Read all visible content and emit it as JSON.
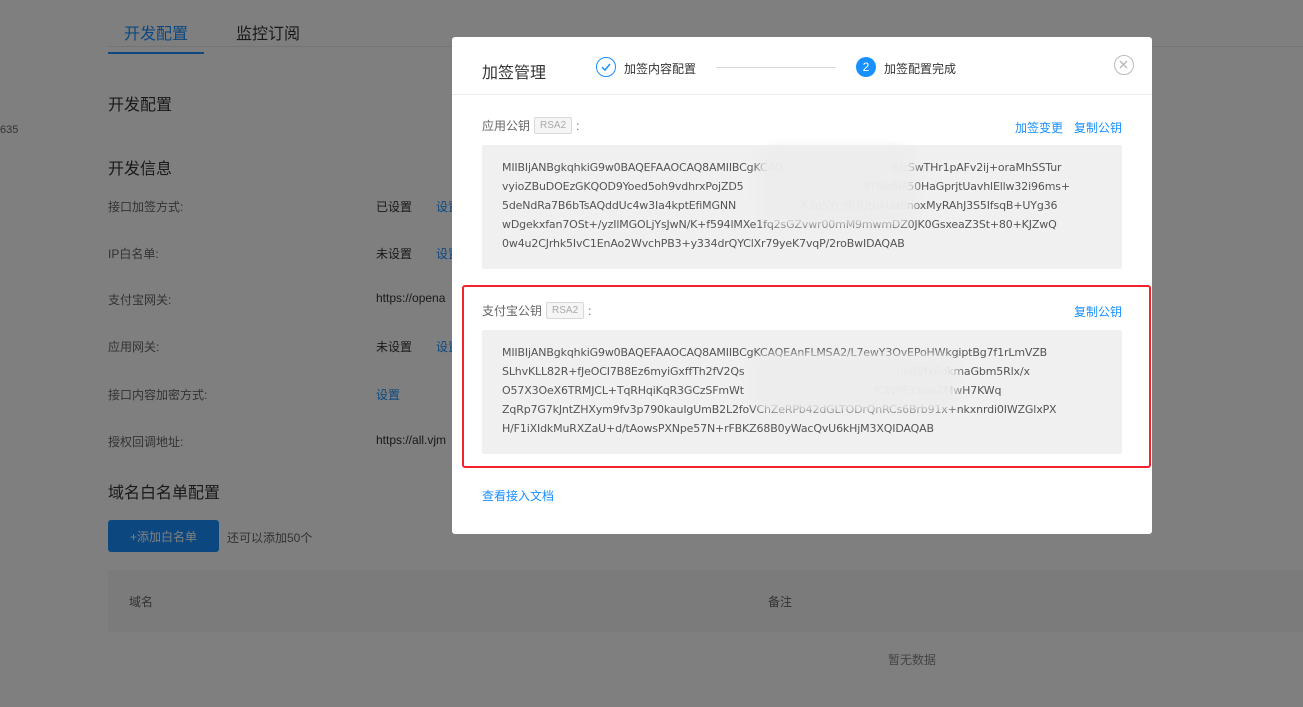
{
  "background": {
    "tabs": [
      {
        "label": "开发配置",
        "active": true
      },
      {
        "label": "监控订阅",
        "active": false
      }
    ],
    "side_number": "635",
    "sections": {
      "dev_config_title": "开发配置",
      "dev_info_title": "开发信息",
      "domain_whitelist_title": "域名白名单配置"
    },
    "rows": [
      {
        "label": "接口加签方式:",
        "value": "已设置",
        "link": "设置"
      },
      {
        "label": "IP白名单:",
        "value": "未设置",
        "link": "设置"
      },
      {
        "label": "支付宝网关:",
        "value": "https://opena",
        "link": ""
      },
      {
        "label": "应用网关:",
        "value": "未设置",
        "link": "设置"
      },
      {
        "label": "接口内容加密方式:",
        "value": "",
        "link": "设置"
      },
      {
        "label": "授权回调地址:",
        "value": "https://all.vjm",
        "link": ""
      }
    ],
    "add_button": "+添加白名单",
    "add_hint": "还可以添加50个",
    "table": {
      "columns": [
        "域名",
        "备注"
      ],
      "empty_text": "暂无数据"
    }
  },
  "modal": {
    "title": "加签管理",
    "steps": [
      {
        "label": "加签内容配置",
        "status": "done"
      },
      {
        "number": "2",
        "label": "加签配置完成",
        "status": "active"
      }
    ],
    "app_key": {
      "label": "应用公钥",
      "badge": "RSA2",
      "colon": ":",
      "actions": [
        "加签变更",
        "复制公钥"
      ],
      "lines": [
        "MIIBIjANBgkqhkiG9w0BAQEFAAOCAQ8AMIIBCgKCAQ          6fzSwTHr1pAFv2ij+oraMhSSTur",
        "vyioZBuDOEzGKQOD9Yoed5oh9vdhrxPojZD5           9TNkBM50HaGprjtUavhlEllw32i96ms+",
        "5deNdRa7B6bTsAQddUc4w3Ia4kptEfiMGNN      K3qSYc/9UQtbxUa8noxMyRAhJ3S5IfsqB+UYg36",
        "wDgekxfan7OSt+/yzIlMGOLjYsJwN/K+f594lMXe1fq2sGZvwr00mM9mwmDZ0JK0GsxeaZ3St+80+KJZwQ",
        "0w4u2CJrhk5IvC1EnAo2WvchPB3+y334drQYClXr79yeK7vqP/2roBwIDAQAB"
      ]
    },
    "alipay_key": {
      "label": "支付宝公钥",
      "badge": "RSA2",
      "colon": ":",
      "actions": [
        "复制公钥"
      ],
      "lines": [
        "MIIBIjANBgkqhkiG9w0BAQEFAAOCAQ8AMIIBCgKCAQEAnFLMSA2/L7ewY3OvEPoHWkgiptBg7f1rLmVZB",
        "SLhvKLL82R+fJeOCI7B8Ez6myiGxffTh2fV2Qs              he8VfxFdkmaGbm5Rlx/x",
        "O57X3OeX6TRMJCL+TqRHqiKqR3GCzSFmWt            fCWPF3YuwZMwH7KWq",
        "ZqRp7G7kJntZHXym9fv3p790kauIgUmB2L2foVChZeRPb42dGLTODrQnRCs6Brb91x+nkxnrdi0IWZGlxPX",
        "H/F1iXIdkMuRXZaU+d/tAowsPXNpe57N+rFBKZ68B0yWacQvU6kHjM3XQIDAQAB"
      ]
    },
    "doc_link": "查看接入文档"
  }
}
